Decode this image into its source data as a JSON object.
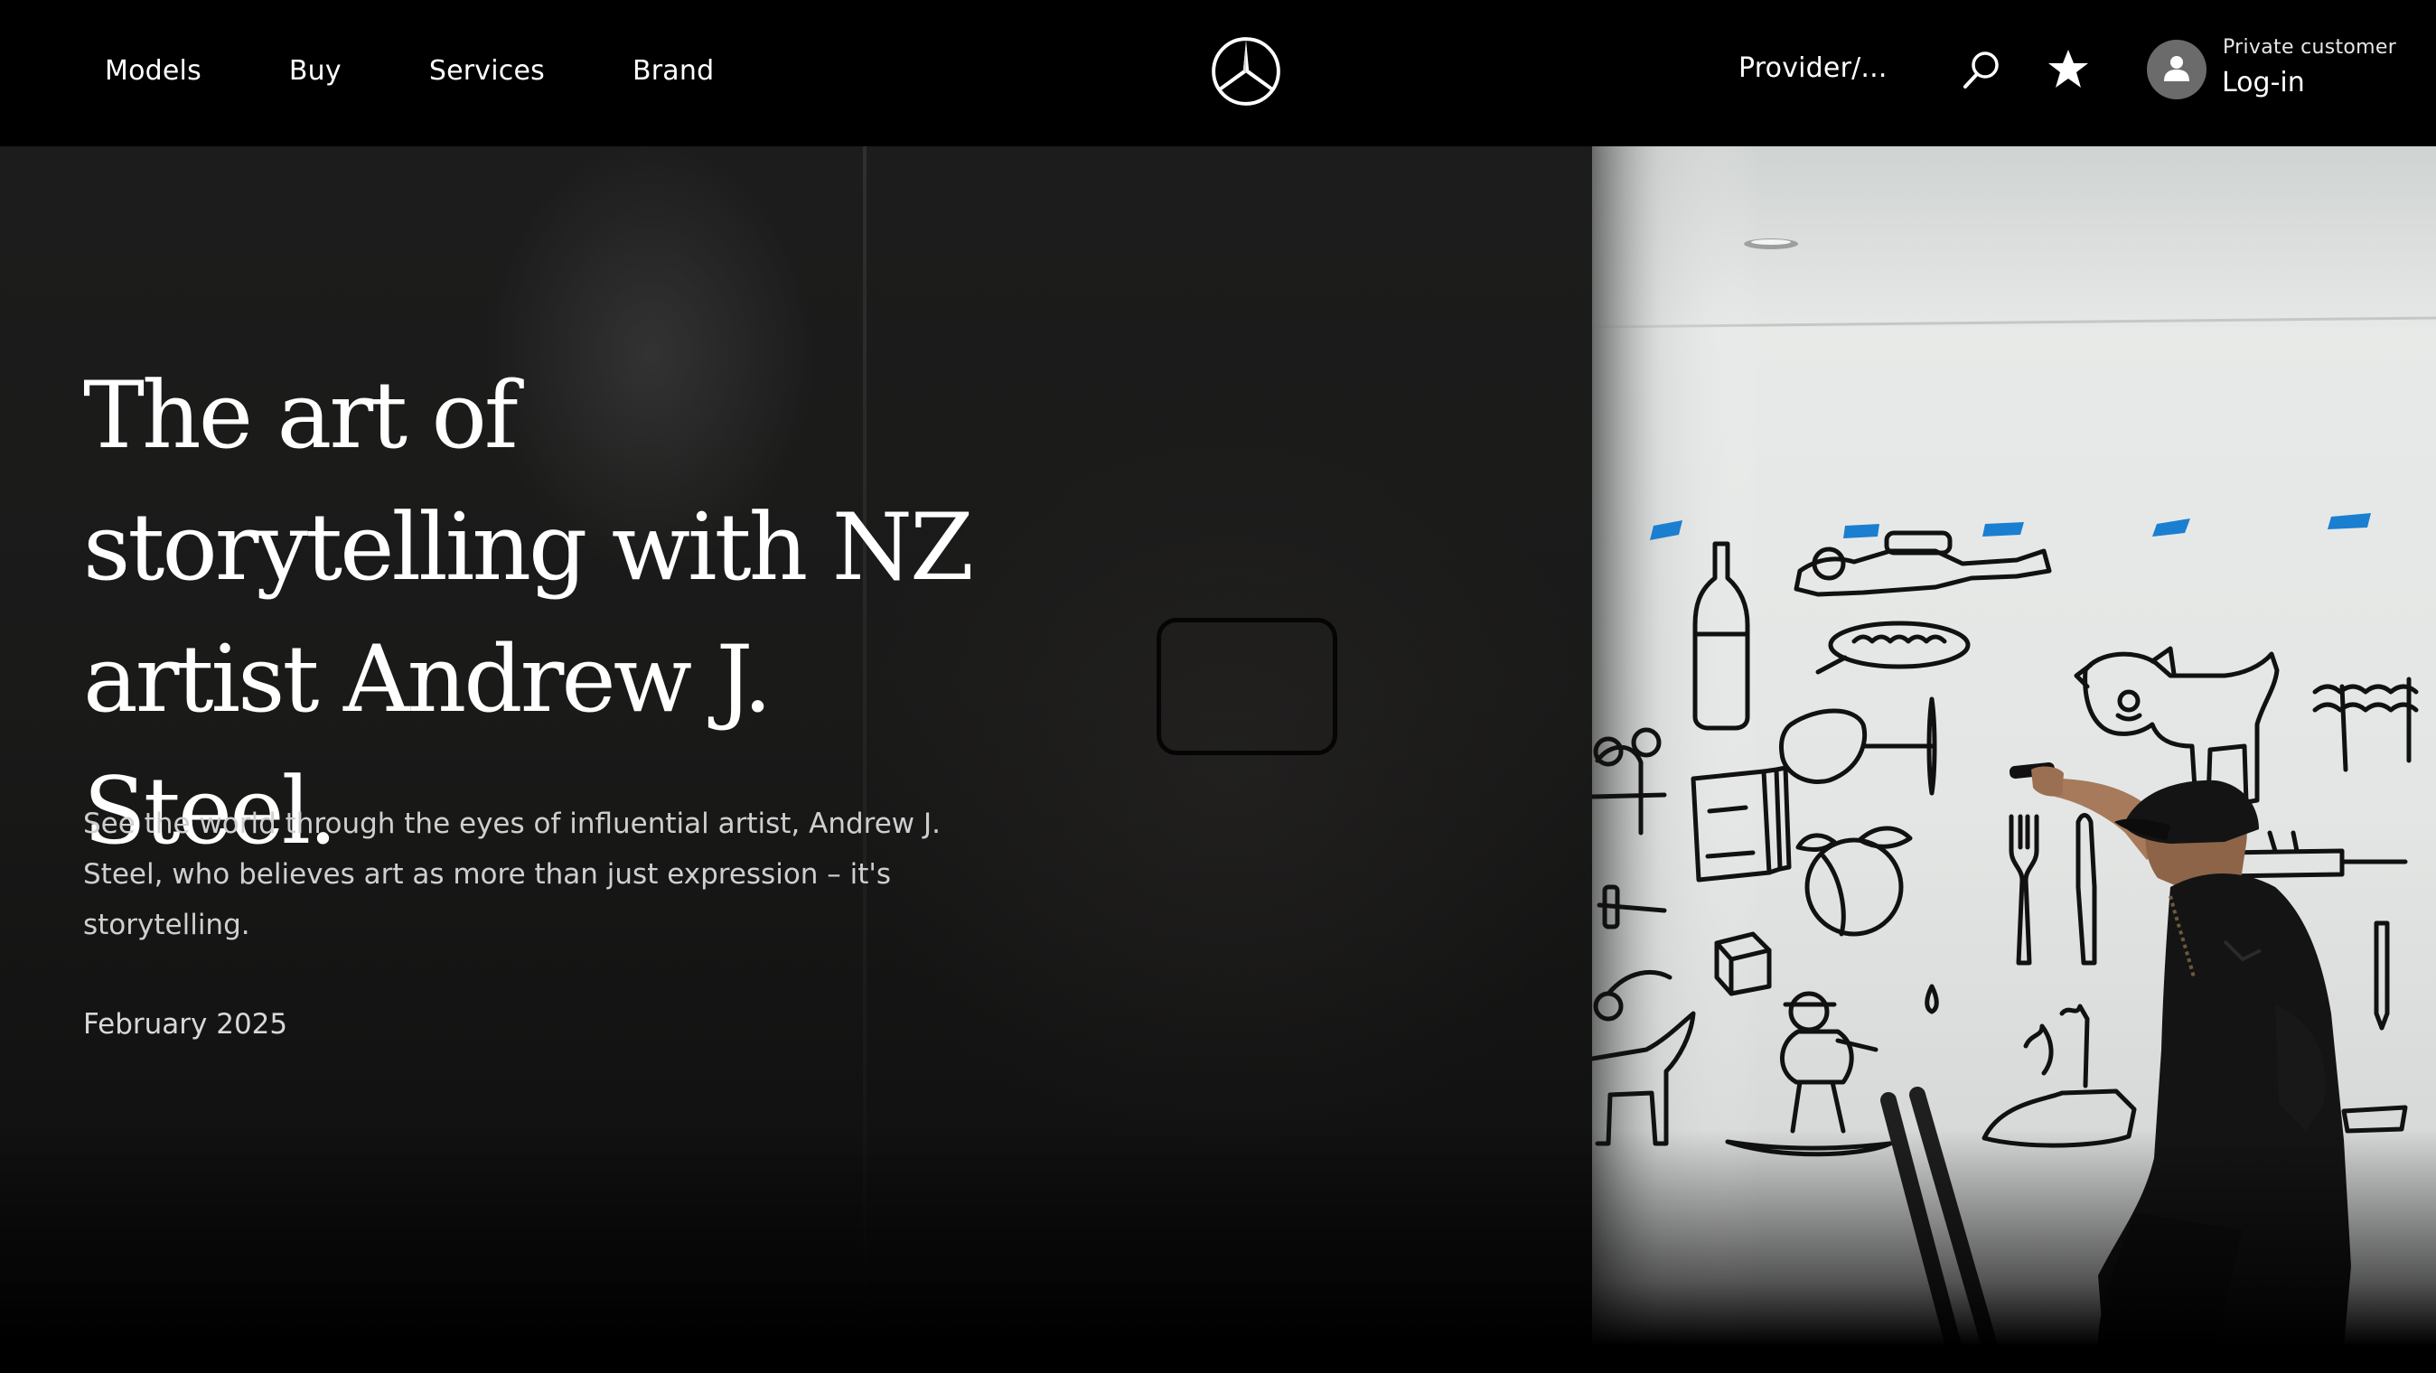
{
  "nav": {
    "items": [
      {
        "label": "Models"
      },
      {
        "label": "Buy"
      },
      {
        "label": "Services"
      },
      {
        "label": "Brand"
      }
    ]
  },
  "header": {
    "logo_icon": "three-pointed-star-logo-icon",
    "provider_label": "Provider/...",
    "search_icon": "search-icon",
    "favorites_icon": "star-icon",
    "account": {
      "type_label": "Private customer",
      "login_label": "Log-in",
      "avatar_icon": "user-icon"
    }
  },
  "hero": {
    "title": "The art of storytelling with NZ artist Andrew J. Steel.",
    "description": "See the world through the eyes of influential artist, Andrew J. Steel, who believes art as more than just expression – it's storytelling.",
    "date": "February 2025"
  },
  "colors": {
    "header_bg": "#000000",
    "text_primary": "#ffffff",
    "text_secondary": "#cfcfcf",
    "avatar_bg": "#6b6b6b"
  }
}
